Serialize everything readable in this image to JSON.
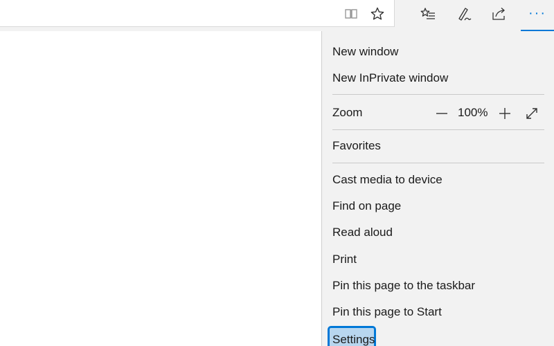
{
  "toolbar": {
    "reading_view_icon": "reading-view-icon",
    "favorite_star_icon": "star-icon",
    "hub_icon": "favorites-hub-icon",
    "notes_icon": "pen-icon",
    "share_icon": "share-icon",
    "more_label": "···",
    "accent_color": "#0078d7"
  },
  "menu": {
    "new_window": "New window",
    "new_inprivate": "New InPrivate window",
    "zoom": {
      "label": "Zoom",
      "value": "100%",
      "zoom_out_icon": "minus-icon",
      "zoom_in_icon": "plus-icon",
      "fullscreen_icon": "fullscreen-icon"
    },
    "favorites": "Favorites",
    "cast": "Cast media to device",
    "find": "Find on page",
    "read_aloud": "Read aloud",
    "print": "Print",
    "pin_taskbar": "Pin this page to the taskbar",
    "pin_start": "Pin this page to Start",
    "settings": "Settings",
    "settings_highlight": "#b8d6ef"
  }
}
